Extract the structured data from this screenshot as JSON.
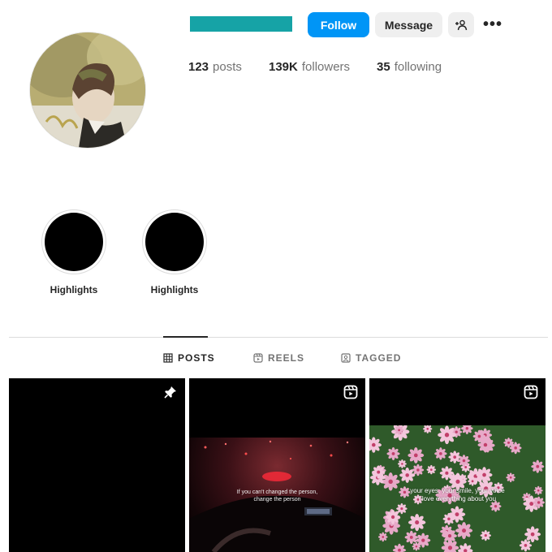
{
  "header": {
    "follow_label": "Follow",
    "message_label": "Message",
    "suggest_icon": "person-add-icon",
    "more_icon": "more-options-icon",
    "more_glyph": "•••",
    "accent_color": "#0095f6",
    "username_redaction_color": "#16a3a6"
  },
  "stats": {
    "posts_count": "123",
    "posts_label": "posts",
    "followers_count": "139K",
    "followers_label": "followers",
    "following_count": "35",
    "following_label": "following"
  },
  "highlights": [
    {
      "label": "Highlights"
    },
    {
      "label": "Highlights"
    }
  ],
  "tabs": [
    {
      "label": "POSTS",
      "icon": "grid-icon",
      "active": true
    },
    {
      "label": "REELS",
      "icon": "reels-icon",
      "active": false
    },
    {
      "label": "TAGGED",
      "icon": "tagged-icon",
      "active": false
    }
  ],
  "posts": [
    {
      "type": "pinned",
      "icon": "pin-icon",
      "caption": ""
    },
    {
      "type": "reel",
      "icon": "reel-icon",
      "caption_line1": "If you can't changed the person,",
      "caption_line2": "change the person"
    },
    {
      "type": "reel",
      "icon": "reel-icon",
      "caption_line1": "your eyes, your smile, your voice",
      "caption_line2": "i love everything about you"
    }
  ]
}
